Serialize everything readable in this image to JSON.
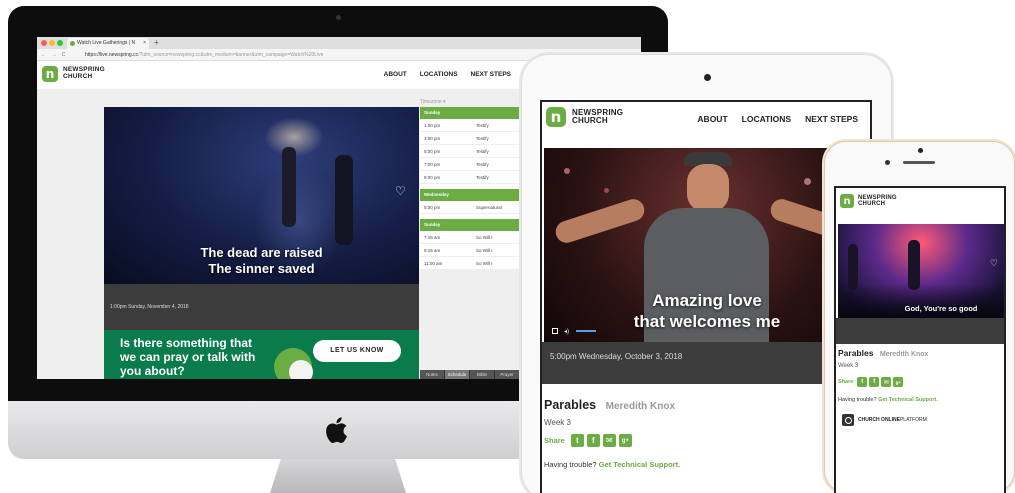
{
  "brand": {
    "name_line1": "NEWSPRING",
    "name_line2": "CHURCH",
    "logo_letter": "n",
    "accent_color": "#6bac43",
    "dark_green": "#0a7c4b"
  },
  "nav": {
    "about": "ABOUT",
    "locations": "LOCATIONS",
    "next_steps": "NEXT STEPS"
  },
  "desktop": {
    "browser": {
      "tab_title": "Watch Live Gatherings | N",
      "tab_close": "×",
      "new_tab": "+",
      "nav_arrows": "← → C",
      "url_host": "https://live.newspring.cc",
      "url_path": "/?utm_source=newspring.cc&utm_medium=banner&utm_campaign=Watch%20Live",
      "bookmark": "☆"
    },
    "video": {
      "lyric_line1": "The dead are raised",
      "lyric_line2": "The sinner saved",
      "caption": "1:00pm Sunday, November 4, 2018"
    },
    "schedule": {
      "timezone": "Timezone ▾",
      "days": [
        {
          "day": "Sunday",
          "rows": [
            {
              "time": "1:00 pm",
              "title": "Testify"
            },
            {
              "time": "3:00 pm",
              "title": "Testify"
            },
            {
              "time": "5:00 pm",
              "title": "Testify"
            },
            {
              "time": "7:00 pm",
              "title": "Testify"
            },
            {
              "time": "9:00 pm",
              "title": "Testify"
            }
          ]
        },
        {
          "day": "Wednesday",
          "rows": [
            {
              "time": "5:00 pm",
              "title": "Supernatural"
            }
          ]
        },
        {
          "day": "Sunday",
          "rows": [
            {
              "time": "7:15 am",
              "title": "So Will I"
            },
            {
              "time": "9:15 am",
              "title": "So Will I"
            },
            {
              "time": "11:00 am",
              "title": "So Will I"
            }
          ]
        }
      ],
      "tabs": [
        "Notes",
        "Schedule",
        "Bible",
        "Prayer"
      ]
    },
    "prayer": {
      "line1": "Is there something that",
      "line2": "we can pray or talk with",
      "line3": "you about?",
      "button": "LET US KNOW"
    }
  },
  "tablet": {
    "video": {
      "lyric_line1": "Amazing love",
      "lyric_line2": "that welcomes me",
      "caption": "5:00pm Wednesday, October 3, 2018"
    },
    "title": "Parables",
    "speaker": "Meredith Knox",
    "week": "Week 3",
    "share_label": "Share",
    "share_icons": [
      "twitter-icon",
      "facebook-icon",
      "email-icon",
      "google-plus-icon"
    ],
    "share_glyphs": [
      "t",
      "f",
      "✉",
      "g+"
    ],
    "trouble_text": "Having trouble?",
    "support_link": "Get Technical Support."
  },
  "phone": {
    "video": {
      "lyric": "God, You're so good"
    },
    "title": "Parables",
    "speaker": "Meredith Knox",
    "week": "Week 3",
    "share_label": "Share",
    "share_glyphs": [
      "t",
      "f",
      "✉",
      "g+"
    ],
    "trouble_text": "Having trouble?",
    "support_link": "Get Technical Support.",
    "platform_bold": "CHURCH ONLINE",
    "platform_rest": " PLATFORM"
  }
}
